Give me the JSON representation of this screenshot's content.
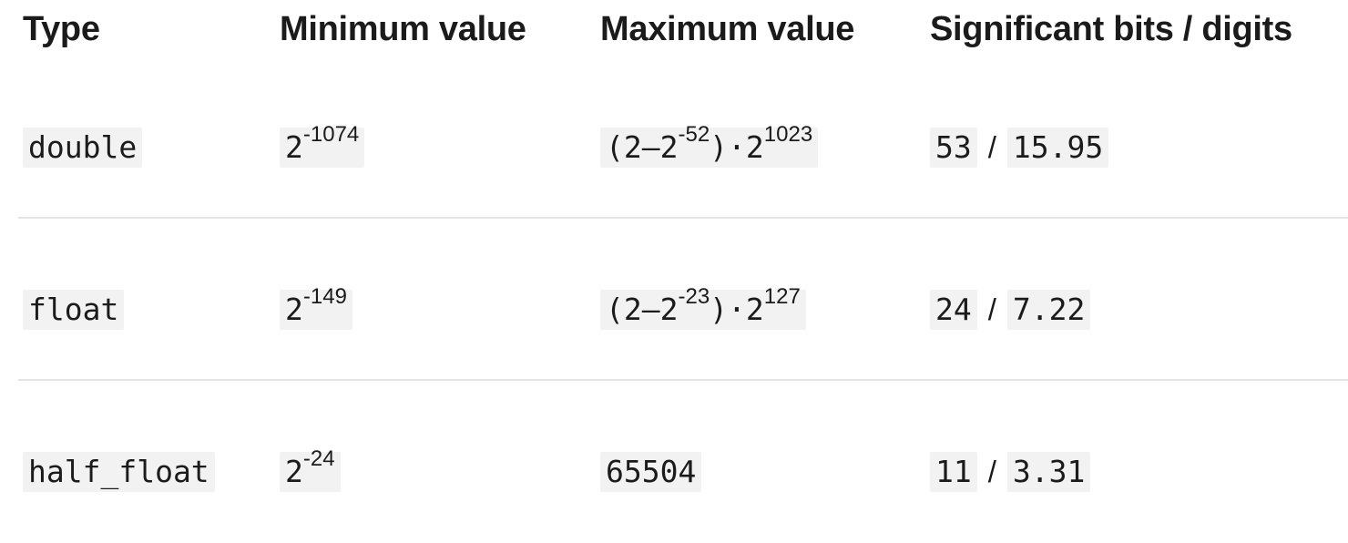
{
  "table": {
    "headers": {
      "type": "Type",
      "min": "Minimum value",
      "max": "Maximum value",
      "sig": "Significant bits / digits"
    },
    "rows": [
      {
        "type": "double",
        "min": {
          "base": "2",
          "exp": "-1074"
        },
        "max": {
          "open": "(2–2",
          "inner_exp": "-52",
          "mid": ")·2",
          "outer_exp": "1023"
        },
        "bits": "53",
        "separator": "/",
        "digits": "15.95"
      },
      {
        "type": "float",
        "min": {
          "base": "2",
          "exp": "-149"
        },
        "max": {
          "open": "(2–2",
          "inner_exp": "-23",
          "mid": ")·2",
          "outer_exp": "127"
        },
        "bits": "24",
        "separator": "/",
        "digits": "7.22"
      },
      {
        "type": "half_float",
        "min": {
          "base": "2",
          "exp": "-24"
        },
        "max_plain": "65504",
        "bits": "11",
        "separator": "/",
        "digits": "3.31"
      }
    ]
  }
}
